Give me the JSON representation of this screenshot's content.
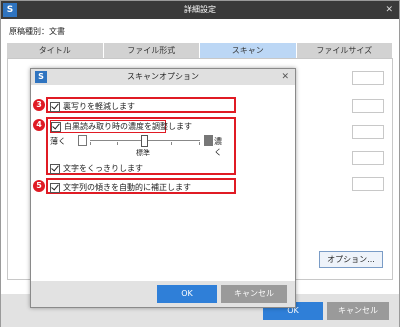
{
  "outer_window": {
    "title": "詳細設定",
    "logo": "S",
    "close_glyph": "✕",
    "doc_type": "原稿種別：文書",
    "tabs": [
      "タイトル",
      "ファイル形式",
      "スキャン",
      "ファイルサイズ"
    ],
    "active_tab": "スキャン",
    "option_button": "オプション...",
    "ok_label": "OK",
    "cancel_label": "キャンセル"
  },
  "dialog": {
    "title": "スキャンオプション",
    "logo": "S",
    "close_glyph": "✕",
    "option_3": "裏写りを軽減します",
    "option_4": "白黒読み取り時の濃度を調整します",
    "slider_light": "薄く",
    "slider_dark": "濃く",
    "slider_center": "標準",
    "option_sharpen": "文字をくっきりします",
    "option_5": "文字列の傾きを自動的に補正します",
    "ok_label": "OK",
    "cancel_label": "キャンセル"
  },
  "callouts": [
    "3",
    "4",
    "5"
  ],
  "colors": {
    "highlight": "#e01b24",
    "primary_button": "#2f7fd8",
    "active_tab": "#bcd7f5"
  }
}
